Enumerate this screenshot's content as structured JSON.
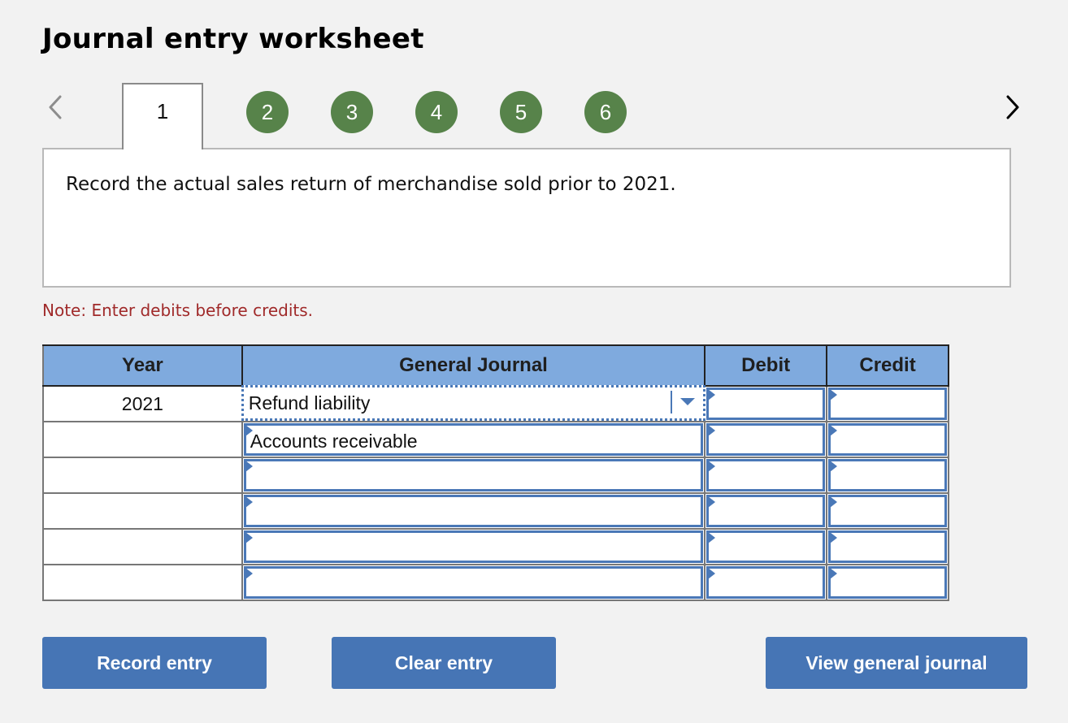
{
  "header": {
    "title": "Journal entry worksheet"
  },
  "navigation": {
    "prev_icon": "chevron-left-icon",
    "next_icon": "chevron-right-icon",
    "steps": [
      {
        "label": "1",
        "state": "active"
      },
      {
        "label": "2",
        "state": "completed"
      },
      {
        "label": "3",
        "state": "completed"
      },
      {
        "label": "4",
        "state": "completed"
      },
      {
        "label": "5",
        "state": "completed"
      },
      {
        "label": "6",
        "state": "completed"
      }
    ]
  },
  "prompt": {
    "text": "Record the actual sales return of merchandise sold prior to 2021."
  },
  "note": "Note: Enter debits before credits.",
  "journal": {
    "headers": {
      "year": "Year",
      "account": "General Journal",
      "debit": "Debit",
      "credit": "Credit"
    },
    "rows": [
      {
        "year": "2021",
        "account": "Refund liability",
        "debit": "",
        "credit": ""
      },
      {
        "year": "",
        "account": "Accounts receivable",
        "debit": "",
        "credit": ""
      },
      {
        "year": "",
        "account": "",
        "debit": "",
        "credit": ""
      },
      {
        "year": "",
        "account": "",
        "debit": "",
        "credit": ""
      },
      {
        "year": "",
        "account": "",
        "debit": "",
        "credit": ""
      },
      {
        "year": "",
        "account": "",
        "debit": "",
        "credit": ""
      }
    ]
  },
  "buttons": {
    "record": "Record entry",
    "clear": "Clear entry",
    "view": "View general journal"
  },
  "colors": {
    "step_completed": "#57834a",
    "header_fill": "#7faade",
    "input_border": "#4a78b7",
    "button_fill": "#4675b5",
    "note_text": "#a02a2a"
  }
}
